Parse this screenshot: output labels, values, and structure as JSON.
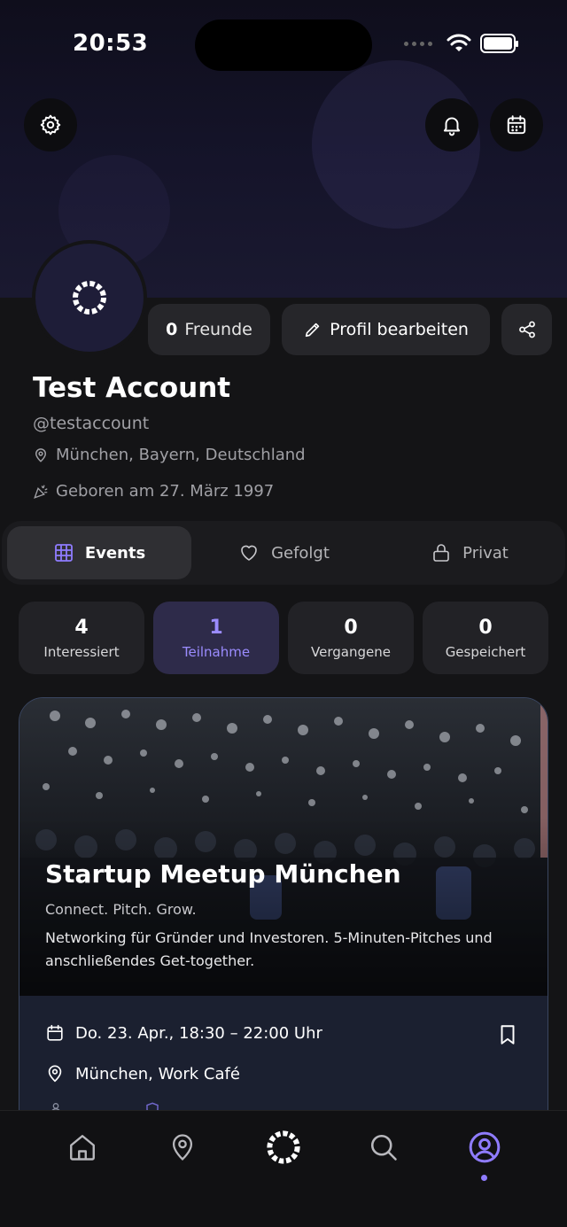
{
  "status_bar": {
    "time": "20:53"
  },
  "profile": {
    "friends_count": "0",
    "friends_label": "Freunde",
    "edit_label": "Profil bearbeiten",
    "name": "Test Account",
    "handle": "@testaccount",
    "location": "München, Bayern, Deutschland",
    "birthday": "Geboren am 27. März 1997"
  },
  "tabs": [
    {
      "label": "Events",
      "icon": "grid-icon",
      "active": true
    },
    {
      "label": "Gefolgt",
      "icon": "heart-icon",
      "active": false
    },
    {
      "label": "Privat",
      "icon": "lock-icon",
      "active": false
    }
  ],
  "stats": [
    {
      "value": "4",
      "label": "Interessiert",
      "active": false
    },
    {
      "value": "1",
      "label": "Teilnahme",
      "active": true
    },
    {
      "value": "0",
      "label": "Vergangene",
      "active": false
    },
    {
      "value": "0",
      "label": "Gespeichert",
      "active": false
    }
  ],
  "event": {
    "title": "Startup Meetup München",
    "subtitle": "Connect. Pitch. Grow.",
    "description": "Networking für Gründer und Investoren. 5-Minuten-Pitches und anschließendes Get-together.",
    "date": "Do. 23. Apr., 18:30 – 22:00 Uhr",
    "location": "München, Work Café"
  },
  "bottom_nav": [
    {
      "icon": "home-icon"
    },
    {
      "icon": "map-pin-icon"
    },
    {
      "icon": "app-logo-icon"
    },
    {
      "icon": "search-icon"
    },
    {
      "icon": "profile-icon",
      "active": true
    }
  ],
  "colors": {
    "accent": "#8f7cff",
    "background": "#141416",
    "card": "#1b2030"
  }
}
